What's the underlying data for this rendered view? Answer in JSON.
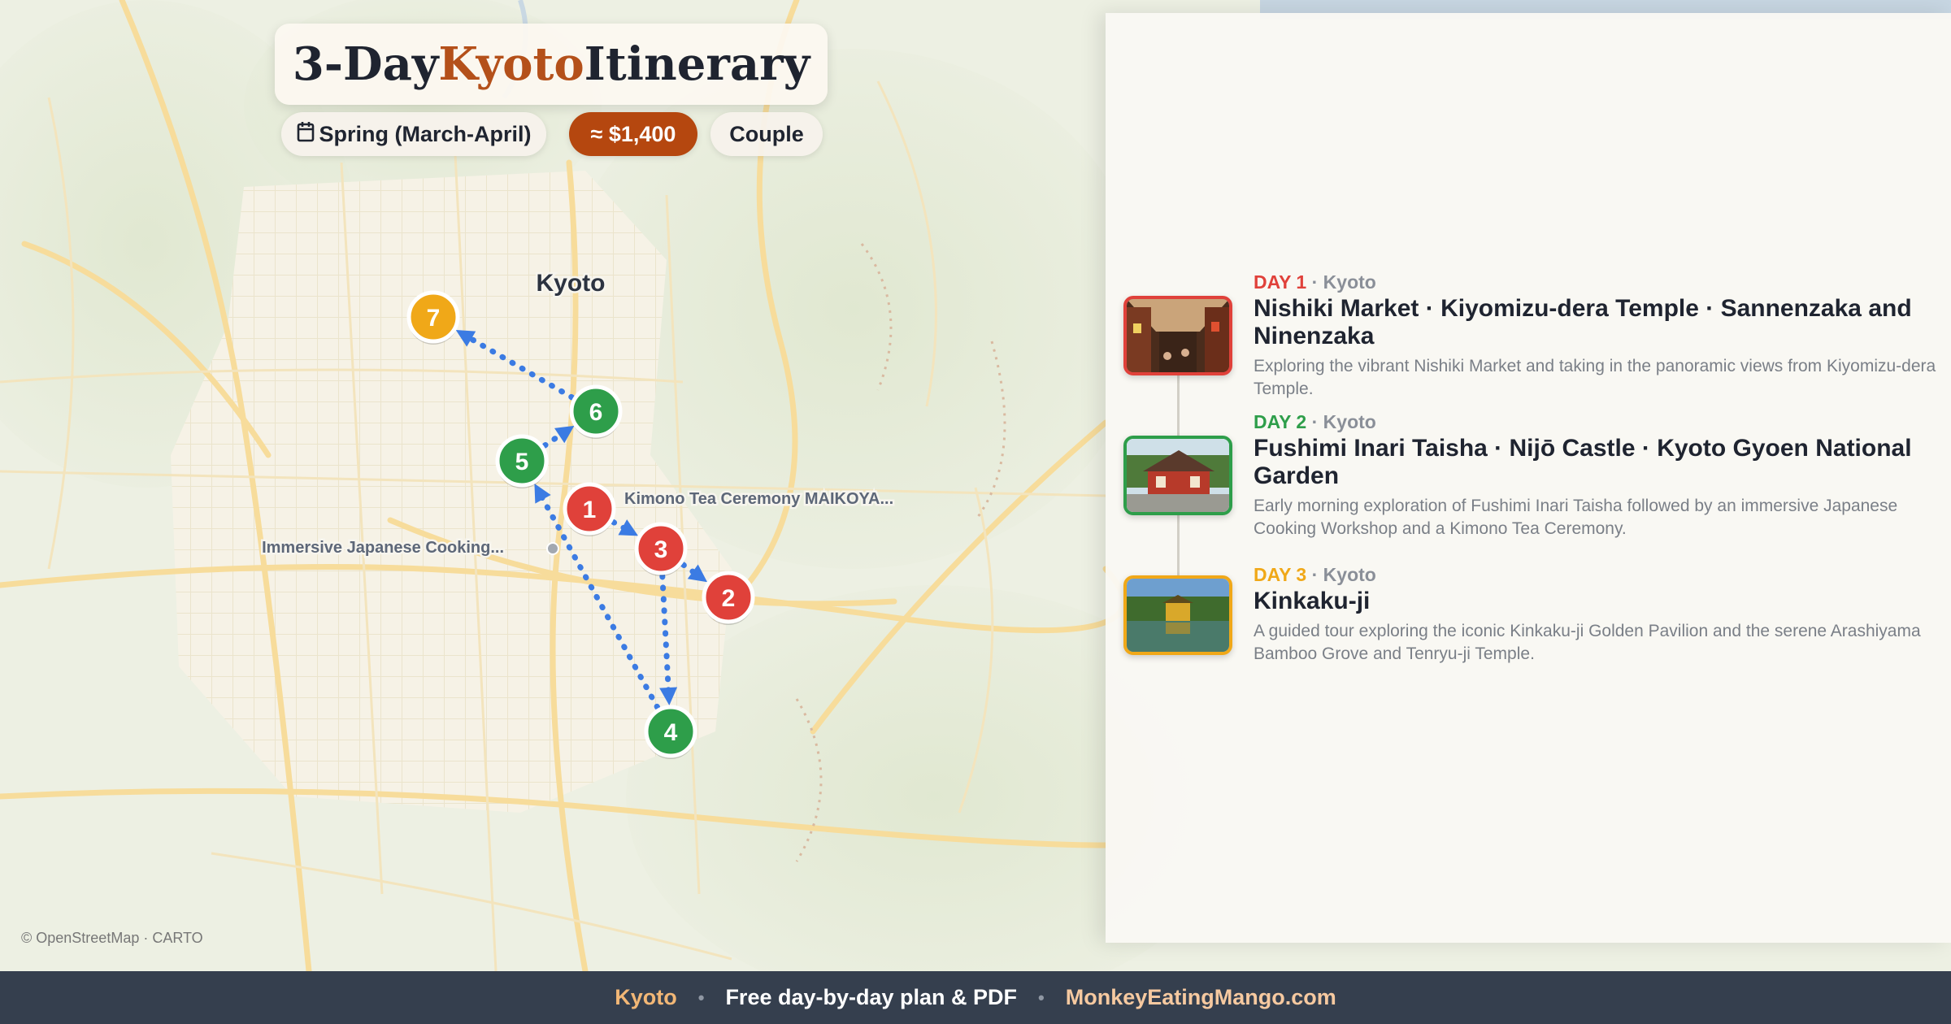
{
  "header": {
    "title_prefix": "3-Day ",
    "title_accent": "Kyoto",
    "title_suffix": " Itinerary",
    "season_icon": "calendar-icon",
    "season": "Spring (March-April)",
    "budget": "≈ $1,400",
    "party": "Couple"
  },
  "map": {
    "city_label": "Kyoto",
    "poi_labels": [
      "Kimono Tea Ceremony MAIKOYA...",
      "Immersive Japanese Cooking..."
    ],
    "attribution": "© OpenStreetMap · CARTO",
    "markers": [
      {
        "num": "1",
        "day": 1
      },
      {
        "num": "2",
        "day": 1
      },
      {
        "num": "3",
        "day": 1
      },
      {
        "num": "4",
        "day": 2
      },
      {
        "num": "5",
        "day": 2
      },
      {
        "num": "6",
        "day": 2
      },
      {
        "num": "7",
        "day": 3
      }
    ],
    "route_style": "dotted-blue-arrows"
  },
  "days": [
    {
      "label": "DAY 1",
      "city": "Kyoto",
      "title": "Nishiki Market · Kiyomizu-dera Temple · Sannenzaka and Ninenzaka",
      "desc": "Exploring the vibrant Nishiki Market and taking in the panoramic views from Kiyomizu-dera Temple.",
      "color": "#e0413a",
      "thumb": "market-photo"
    },
    {
      "label": "DAY 2",
      "city": "Kyoto",
      "title": "Fushimi Inari Taisha · Nijō Castle · Kyoto Gyoen National Garden",
      "desc": "Early morning exploration of Fushimi Inari Taisha followed by an immersive Japanese Cooking Workshop and a Kimono Tea Ceremony.",
      "color": "#2e9e4a",
      "thumb": "shrine-photo"
    },
    {
      "label": "DAY 3",
      "city": "Kyoto",
      "title": "Kinkaku-ji",
      "desc": "A guided tour exploring the iconic Kinkaku-ji Golden Pavilion and the serene Arashiyama Bamboo Grove and Tenryu-ji Temple.",
      "color": "#f0a818",
      "thumb": "golden-pavilion-photo"
    }
  ],
  "footer": {
    "city": "Kyoto",
    "tagline": "Free day-by-day plan & PDF",
    "site": "MonkeyEatingMango.com",
    "separator": "•"
  },
  "colors": {
    "day1": "#e0413a",
    "day2": "#2e9e4a",
    "day3": "#f0a818",
    "route": "#3b7be3",
    "accent": "#b4501a",
    "footer_bg": "#353f4e"
  }
}
